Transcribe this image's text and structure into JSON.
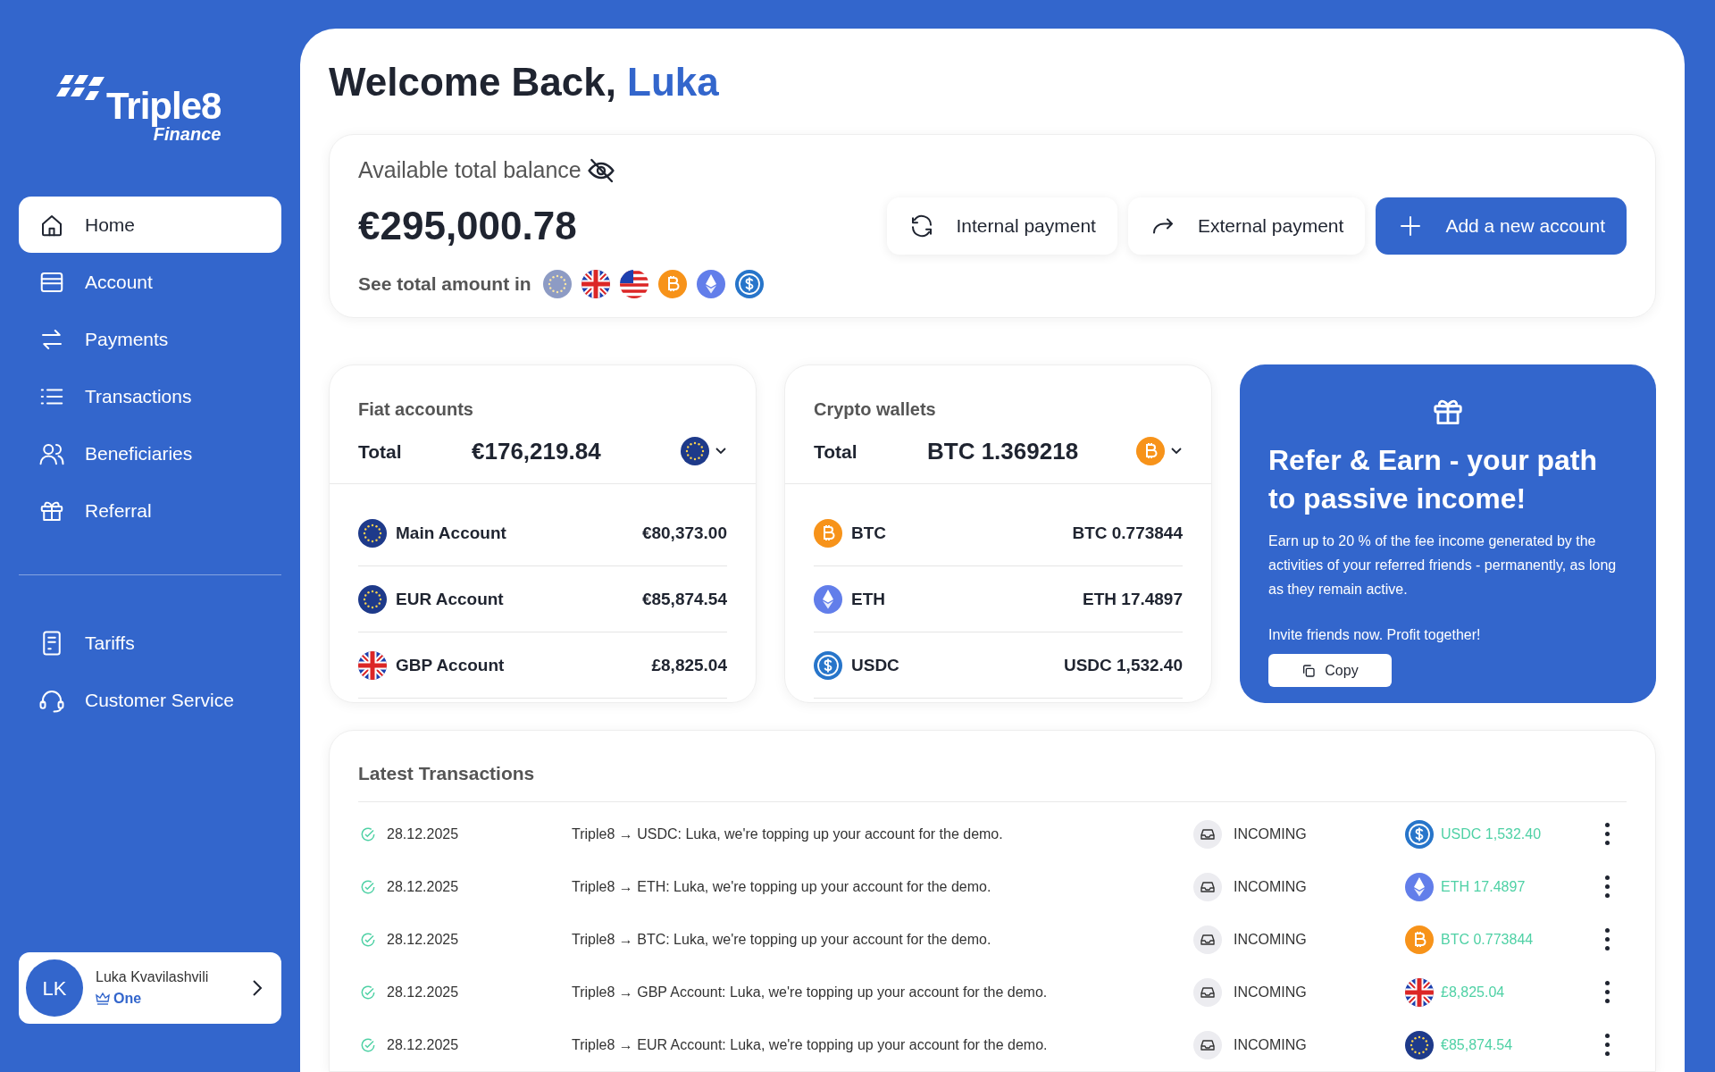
{
  "sidebar": {
    "logo": {
      "name": "Triple8",
      "sub": "Finance"
    },
    "nav_items": [
      {
        "label": "Home",
        "kind": "home",
        "selected": true
      },
      {
        "label": "Account",
        "kind": "card",
        "selected": false
      },
      {
        "label": "Payments",
        "kind": "swap",
        "selected": false
      },
      {
        "label": "Transactions",
        "kind": "list",
        "selected": false
      },
      {
        "label": "Beneficiaries",
        "kind": "users",
        "selected": false
      },
      {
        "label": "Referral",
        "kind": "gift",
        "selected": false
      }
    ],
    "secondary_items": [
      {
        "label": "Tariffs",
        "kind": "doc",
        "selected": false
      },
      {
        "label": "Customer Service",
        "kind": "headset",
        "selected": false
      }
    ],
    "user": {
      "initials": "LK",
      "name": "Luka Kvavilashvili",
      "plan": "One"
    }
  },
  "header": {
    "greeting": "Welcome Back,",
    "name": "Luka"
  },
  "balance": {
    "label": "Available total balance",
    "amount": "€295,000.78",
    "see_label": "See total amount in",
    "currencies": [
      {
        "kind": "eur",
        "selected": true
      },
      {
        "kind": "gbp",
        "selected": false
      },
      {
        "kind": "usd",
        "selected": false
      },
      {
        "kind": "btc",
        "selected": false
      },
      {
        "kind": "eth",
        "selected": false
      },
      {
        "kind": "usdc",
        "selected": false
      }
    ],
    "actions": [
      {
        "label": "Internal payment",
        "kind": "refresh",
        "primary": false
      },
      {
        "label": "External payment",
        "kind": "forward",
        "primary": false
      },
      {
        "label": "Add a new account",
        "kind": "plus",
        "primary": true
      }
    ]
  },
  "fiat": {
    "title": "Fiat accounts",
    "total_label": "Total",
    "total": "€176,219.84",
    "currency_icon": {
      "kind": "eur"
    },
    "rows": [
      {
        "kind": "eur",
        "name": "Main Account",
        "amount": "€80,373.00"
      },
      {
        "kind": "eur",
        "name": "EUR Account",
        "amount": "€85,874.54"
      },
      {
        "kind": "gbp",
        "name": "GBP Account",
        "amount": "£8,825.04"
      }
    ]
  },
  "crypto": {
    "title": "Crypto wallets",
    "total_label": "Total",
    "total": "BTC 1.369218",
    "currency_icon": {
      "kind": "btc"
    },
    "rows": [
      {
        "kind": "btc",
        "name": "BTC",
        "amount": "BTC 0.773844"
      },
      {
        "kind": "eth",
        "name": "ETH",
        "amount": "ETH 17.4897"
      },
      {
        "kind": "usdc",
        "name": "USDC",
        "amount": "USDC 1,532.40"
      }
    ]
  },
  "referral": {
    "title": "Refer & Earn - your path to passive income!",
    "body": "Earn up to 20 % of the fee income generated by the activities of your referred friends - permanently, as long as they remain active.",
    "invite": "Invite friends now. Profit together!",
    "copy_label": "Copy"
  },
  "transactions": {
    "title": "Latest Transactions",
    "rows": [
      {
        "date": "28.12.2025",
        "description": "Triple8 → USDC: Luka, we're topping up your account for the demo.",
        "direction": "INCOMING",
        "kind": "usdc",
        "amount": "USDC 1,532.40"
      },
      {
        "date": "28.12.2025",
        "description": "Triple8 → ETH: Luka, we're topping up your account for the demo.",
        "direction": "INCOMING",
        "kind": "eth",
        "amount": "ETH 17.4897"
      },
      {
        "date": "28.12.2025",
        "description": "Triple8 → BTC: Luka, we're topping up your account for the demo.",
        "direction": "INCOMING",
        "kind": "btc",
        "amount": "BTC 0.773844"
      },
      {
        "date": "28.12.2025",
        "description": "Triple8 → GBP Account: Luka, we're topping up your account for the demo.",
        "direction": "INCOMING",
        "kind": "gbp",
        "amount": "£8,825.04"
      },
      {
        "date": "28.12.2025",
        "description": "Triple8 → EUR Account: Luka, we're topping up your account for the demo.",
        "direction": "INCOMING",
        "kind": "eur",
        "amount": "€85,874.54"
      }
    ]
  }
}
